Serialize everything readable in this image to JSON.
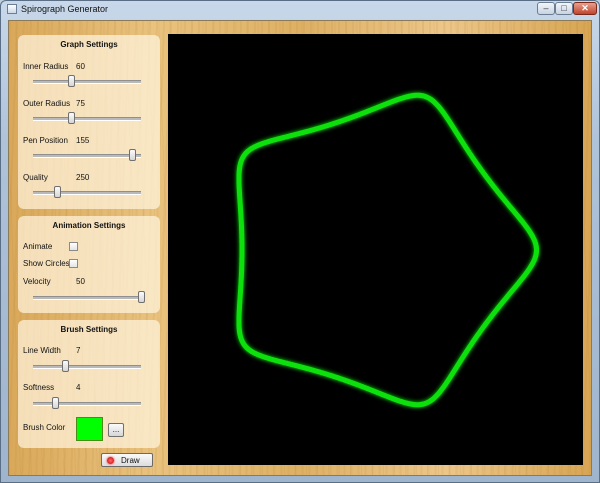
{
  "window": {
    "title": "Spirograph Generator",
    "controls": {
      "minimize": "–",
      "maximize": "□",
      "close": "✕"
    }
  },
  "graph_settings": {
    "title": "Graph Settings",
    "inner_radius": {
      "label": "Inner Radius",
      "value": "60",
      "fraction": 0.35
    },
    "outer_radius": {
      "label": "Outer Radius",
      "value": "75",
      "fraction": 0.35
    },
    "pen_position": {
      "label": "Pen Position",
      "value": "155",
      "fraction": 0.92
    },
    "quality": {
      "label": "Quality",
      "value": "250",
      "fraction": 0.22
    }
  },
  "animation_settings": {
    "title": "Animation Settings",
    "animate": {
      "label": "Animate",
      "checked": false
    },
    "show_circles": {
      "label": "Show Circles",
      "checked": false
    },
    "velocity": {
      "label": "Velocity",
      "value": "50",
      "fraction": 1.0
    }
  },
  "brush_settings": {
    "title": "Brush Settings",
    "line_width": {
      "label": "Line Width",
      "value": "7",
      "fraction": 0.3
    },
    "softness": {
      "label": "Softness",
      "value": "4",
      "fraction": 0.2
    },
    "brush_color": {
      "label": "Brush Color",
      "color": "#00ff00",
      "button": "..."
    }
  },
  "draw_button": {
    "label": "Draw",
    "icon": "red-star-icon"
  },
  "canvas": {
    "background": "#000000",
    "stroke_color": "#10e010",
    "glow_color": "#00ff00"
  }
}
